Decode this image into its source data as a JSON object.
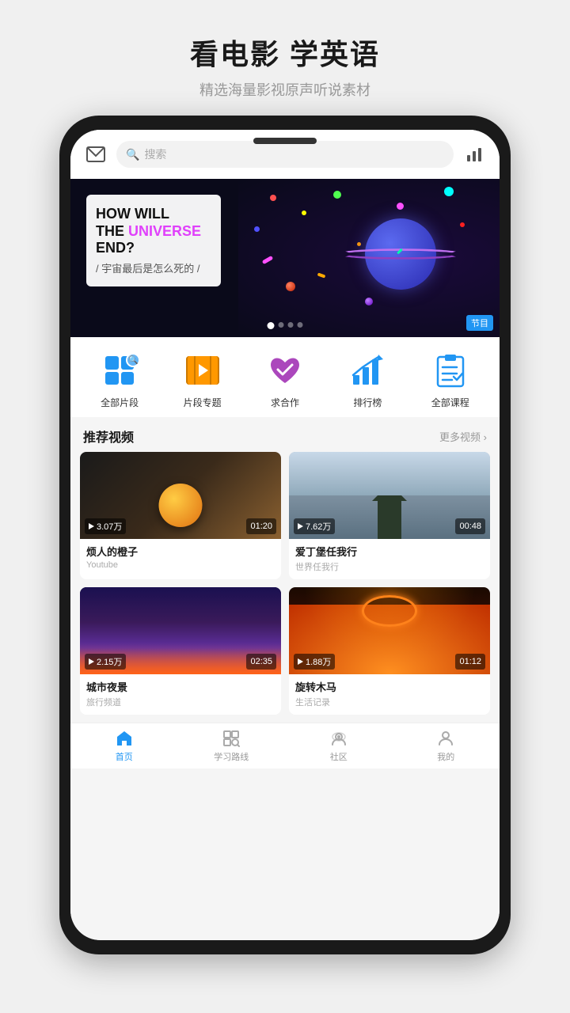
{
  "header": {
    "title": "看电影 学英语",
    "subtitle": "精选海量影视原声听说素材"
  },
  "search": {
    "placeholder": "搜索"
  },
  "banner": {
    "line1": "HOW WILL",
    "line2": "THE ",
    "universe": "UNIVERSE",
    "line3": "END?",
    "chinese": "/ 宇宙最后是怎么死的 /",
    "tag": "节目"
  },
  "categories": [
    {
      "id": "all-clips",
      "label": "全部片段",
      "icon": "segments"
    },
    {
      "id": "clip-topics",
      "label": "片段专题",
      "icon": "film"
    },
    {
      "id": "cooperation",
      "label": "求合作",
      "icon": "heart"
    },
    {
      "id": "ranking",
      "label": "排行榜",
      "icon": "chart"
    },
    {
      "id": "all-courses",
      "label": "全部课程",
      "icon": "clipboard"
    }
  ],
  "recommended": {
    "title": "推荐视频",
    "more_label": "更多视频 ›"
  },
  "videos": [
    {
      "id": "v1",
      "title": "烦人的橙子",
      "source": "Youtube",
      "views": "3.07万",
      "duration": "01:20",
      "thumb": "orange"
    },
    {
      "id": "v2",
      "title": "爱丁堡任我行",
      "source": "世界任我行",
      "views": "7.62万",
      "duration": "00:48",
      "thumb": "church"
    },
    {
      "id": "v3",
      "title": "城市夜景",
      "source": "旅行频道",
      "views": "2.15万",
      "duration": "02:35",
      "thumb": "city"
    },
    {
      "id": "v4",
      "title": "旋转木马",
      "source": "生活记录",
      "views": "1.88万",
      "duration": "01:12",
      "thumb": "carousel"
    }
  ],
  "nav": {
    "items": [
      {
        "id": "home",
        "label": "首页",
        "active": true
      },
      {
        "id": "learning",
        "label": "学习路线",
        "active": false
      },
      {
        "id": "community",
        "label": "社区",
        "active": false
      },
      {
        "id": "profile",
        "label": "我的",
        "active": false
      }
    ]
  }
}
